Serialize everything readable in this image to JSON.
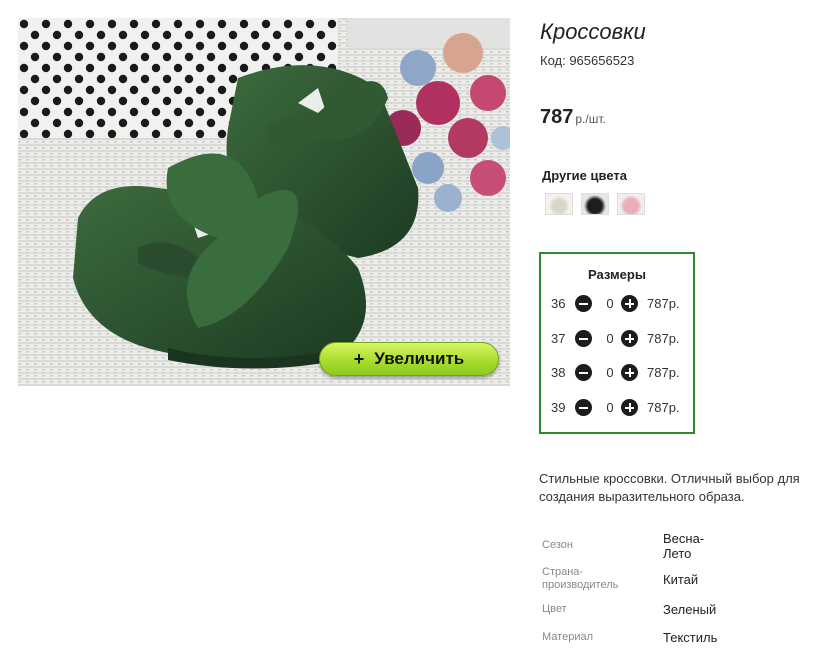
{
  "product": {
    "title": "Кроссовки",
    "code": "Код: 965656523",
    "price_value": "787",
    "price_unit": "р./шт.",
    "zoom_plus": "+",
    "zoom_label": "Увеличить"
  },
  "colors": {
    "title": "Другие цвета",
    "swatches": [
      "white",
      "black",
      "pink"
    ]
  },
  "sizes": {
    "title": "Размеры",
    "rows": [
      {
        "size": "36",
        "qty": "0",
        "price": "787р."
      },
      {
        "size": "37",
        "qty": "0",
        "price": "787р."
      },
      {
        "size": "38",
        "qty": "0",
        "price": "787р."
      },
      {
        "size": "39",
        "qty": "0",
        "price": "787р."
      }
    ]
  },
  "description": "Стильные кроссовки. Отличный выбор для создания выразительного образа.",
  "attributes": [
    {
      "key": "Сезон",
      "value": "Весна-\nЛето"
    },
    {
      "key": "Страна-\nпроизводитель",
      "value": "Китай"
    },
    {
      "key": "Цвет",
      "value": "Зеленый"
    },
    {
      "key": "Материал",
      "value": "Текстиль"
    }
  ],
  "colors_palette": {
    "accent_green": "#2f8a2f",
    "button_lime": "#a9de2e"
  }
}
